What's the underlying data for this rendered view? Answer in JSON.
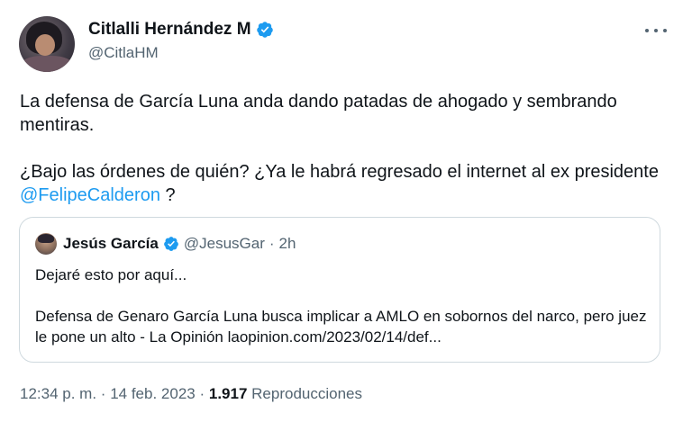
{
  "author": {
    "display_name": "Citlalli Hernández M",
    "handle": "@CitlaHM",
    "verified": true
  },
  "tweet": {
    "paragraph1": "La defensa de García Luna anda dando patadas de ahogado y sembrando mentiras.",
    "paragraph2_before": "¿Bajo las órdenes de quién? ¿Ya le habrá regresado el internet al ex presidente ",
    "paragraph2_mention": "@FelipeCalderon",
    "paragraph2_after": " ?"
  },
  "quote": {
    "display_name": "Jesús García",
    "handle": "@JesusGar",
    "separator": "·",
    "time": "2h",
    "line1": "Dejaré esto por aquí...",
    "line2": "Defensa de Genaro García Luna busca implicar a AMLO en sobornos del narco, pero juez le pone un alto - La Opinión laopinion.com/2023/02/14/def..."
  },
  "footer": {
    "time": "12:34 p. m.",
    "sep1": "·",
    "date": "14 feb. 2023",
    "sep2": "·",
    "views_count": "1.917",
    "views_label": "Reproducciones"
  },
  "colors": {
    "accent": "#1d9bf0",
    "text": "#0f1419",
    "secondary": "#536471",
    "border": "#cfd9de"
  },
  "icons": {
    "verified": "verified-badge-icon",
    "more": "more-horizontal-icon"
  }
}
